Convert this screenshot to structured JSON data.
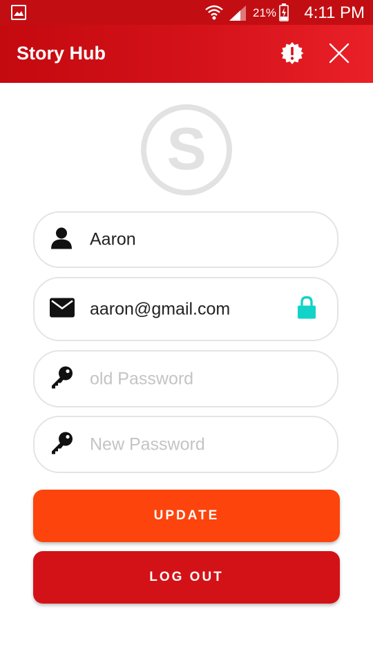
{
  "status_bar": {
    "battery_percent": "21%",
    "time": "4:11 PM",
    "icons": [
      "gallery-icon",
      "wifi-icon",
      "signal-icon",
      "battery-charging-icon"
    ]
  },
  "app_bar": {
    "title": "Story Hub",
    "icons": [
      "alert-icon",
      "close-icon"
    ]
  },
  "logo": {
    "letter": "S"
  },
  "form": {
    "name": {
      "value": "Aaron",
      "icon": "user-icon"
    },
    "email": {
      "value": "aaron@gmail.com",
      "icon": "mail-icon",
      "trailing_icon": "lock-icon"
    },
    "old_password": {
      "placeholder": "old Password",
      "icon": "key-icon"
    },
    "new_password": {
      "placeholder": "New Password",
      "icon": "key-icon"
    }
  },
  "buttons": {
    "update_label": "UPDATE",
    "logout_label": "LOG OUT"
  },
  "colors": {
    "status_bar": "#c20e12",
    "app_bar_start": "#c4090f",
    "app_bar_end": "#ea2027",
    "update_button": "#fc440c",
    "logout_button": "#d31217",
    "lock_accent": "#12d3c8",
    "logo_gray": "#e2e2e2"
  }
}
